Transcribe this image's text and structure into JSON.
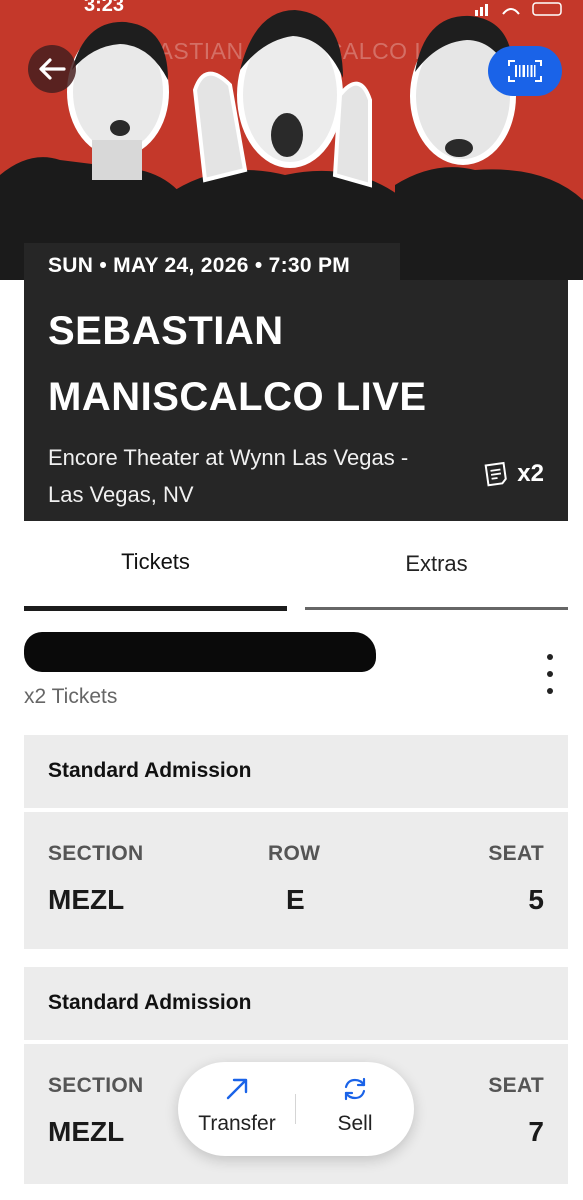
{
  "status_bar": {
    "time": "3:23"
  },
  "hero": {
    "watermark": "SEBASTIAN MANISCALCO LIVE",
    "back_icon": "arrow-left-icon",
    "barcode_icon": "barcode-scan-icon"
  },
  "event": {
    "datetime": "SUN • MAY 24, 2026 • 7:30 PM",
    "title_line1": "SEBASTIAN",
    "title_line2": "MANISCALCO LIVE",
    "venue_line1": "Encore Theater at Wynn Las Vegas -",
    "venue_line2": "Las Vegas, NV",
    "ticket_count": "x2",
    "ticket_icon": "ticket-stack-icon"
  },
  "tabs": [
    {
      "label": "Tickets",
      "active": true
    },
    {
      "label": "Extras",
      "active": false
    }
  ],
  "owner": {
    "name_redacted": "",
    "ticket_qty": "x2 Tickets",
    "menu_icon": "kebab-menu-icon"
  },
  "tickets": [
    {
      "admission": "Standard Admission",
      "section_label": "SECTION",
      "section": "MEZL",
      "row_label": "ROW",
      "row": "E",
      "seat_label": "SEAT",
      "seat": "5"
    },
    {
      "admission": "Standard Admission",
      "section_label": "SECTION",
      "section": "MEZL",
      "seat_label": "SEAT",
      "seat": "7"
    }
  ],
  "actions": [
    {
      "label": "Transfer",
      "icon": "transfer-arrow-icon"
    },
    {
      "label": "Sell",
      "icon": "sell-cycle-icon"
    }
  ],
  "colors": {
    "hero_red": "#c4382a",
    "card_dark": "#262626",
    "accent_blue": "#1a63e8",
    "panel_gray": "#ececec"
  }
}
